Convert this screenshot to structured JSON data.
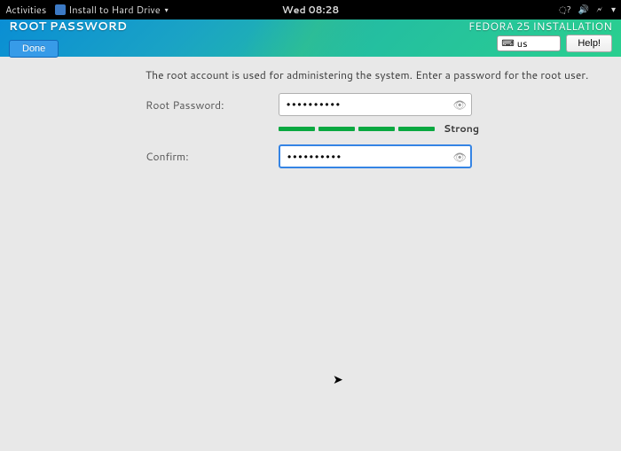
{
  "topbar": {
    "activities": "Activities",
    "app_name": "Install to Hard Drive",
    "clock": "Wed 08:28"
  },
  "header": {
    "title": "ROOT PASSWORD",
    "installer": "FEDORA 25 INSTALLATION",
    "done_label": "Done",
    "help_label": "Help!",
    "keyboard_layout": "us"
  },
  "content": {
    "description": "The root account is used for administering the system.  Enter a password for the root user.",
    "password_label": "Root Password:",
    "confirm_label": "Confirm:",
    "password_value": "••••••••••",
    "confirm_value": "••••••••••",
    "strength_label": "Strong"
  }
}
